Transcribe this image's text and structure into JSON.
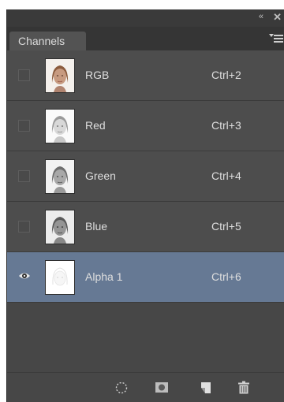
{
  "panel": {
    "tab_label": "Channels",
    "collapse_glyph": "«",
    "close_glyph": "✕",
    "menu_icon": "panel-menu-icon"
  },
  "channels": [
    {
      "name": "RGB",
      "shortcut": "Ctrl+2",
      "visible": false,
      "selected": false,
      "thumb": "color"
    },
    {
      "name": "Red",
      "shortcut": "Ctrl+3",
      "visible": false,
      "selected": false,
      "thumb": "gray"
    },
    {
      "name": "Green",
      "shortcut": "Ctrl+4",
      "visible": false,
      "selected": false,
      "thumb": "gray"
    },
    {
      "name": "Blue",
      "shortcut": "Ctrl+5",
      "visible": false,
      "selected": false,
      "thumb": "gray"
    },
    {
      "name": "Alpha 1",
      "shortcut": "Ctrl+6",
      "visible": true,
      "selected": true,
      "thumb": "alpha"
    }
  ],
  "footer": {
    "buttons": [
      {
        "icon": "load-selection-icon"
      },
      {
        "icon": "save-selection-icon"
      },
      {
        "icon": "new-channel-icon"
      },
      {
        "icon": "delete-channel-icon"
      }
    ]
  },
  "colors": {
    "panel_bg": "#474747",
    "row_bg": "#4d4d4d",
    "selected_row_bg": "#667994",
    "text": "#dedede"
  }
}
